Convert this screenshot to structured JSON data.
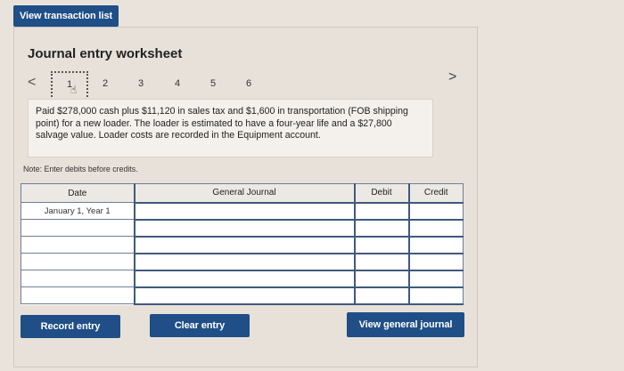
{
  "header": {
    "view_transactions_label": "View transaction list"
  },
  "worksheet": {
    "title": "Journal entry worksheet",
    "nav": {
      "prev": "<",
      "next": ">"
    },
    "steps": [
      "1",
      "2",
      "3",
      "4",
      "5",
      "6"
    ],
    "active_step": "1",
    "description": "Paid $278,000 cash plus $11,120 in sales tax and $1,600 in transportation (FOB shipping point) for a new loader. The loader is estimated to have a four-year life and a $27,800 salvage value. Loader costs are recorded in the Equipment account.",
    "note": "Note: Enter debits before credits."
  },
  "table": {
    "headers": {
      "date": "Date",
      "general_journal": "General Journal",
      "debit": "Debit",
      "credit": "Credit"
    },
    "rows": [
      {
        "date": "January 1, Year 1",
        "general_journal": "",
        "debit": "",
        "credit": ""
      },
      {
        "date": "",
        "general_journal": "",
        "debit": "",
        "credit": ""
      },
      {
        "date": "",
        "general_journal": "",
        "debit": "",
        "credit": ""
      },
      {
        "date": "",
        "general_journal": "",
        "debit": "",
        "credit": ""
      },
      {
        "date": "",
        "general_journal": "",
        "debit": "",
        "credit": ""
      },
      {
        "date": "",
        "general_journal": "",
        "debit": "",
        "credit": ""
      }
    ]
  },
  "buttons": {
    "record_entry": "Record entry",
    "clear_entry": "Clear entry",
    "view_general_journal": "View general journal"
  },
  "colors": {
    "button_bg": "#1f4f86",
    "page_bg": "#eae3db",
    "grid_border": "#3e5a7c"
  },
  "icons": {
    "pointer": "hand-pointer-icon",
    "prev": "chevron-left-icon",
    "next": "chevron-right-icon"
  }
}
